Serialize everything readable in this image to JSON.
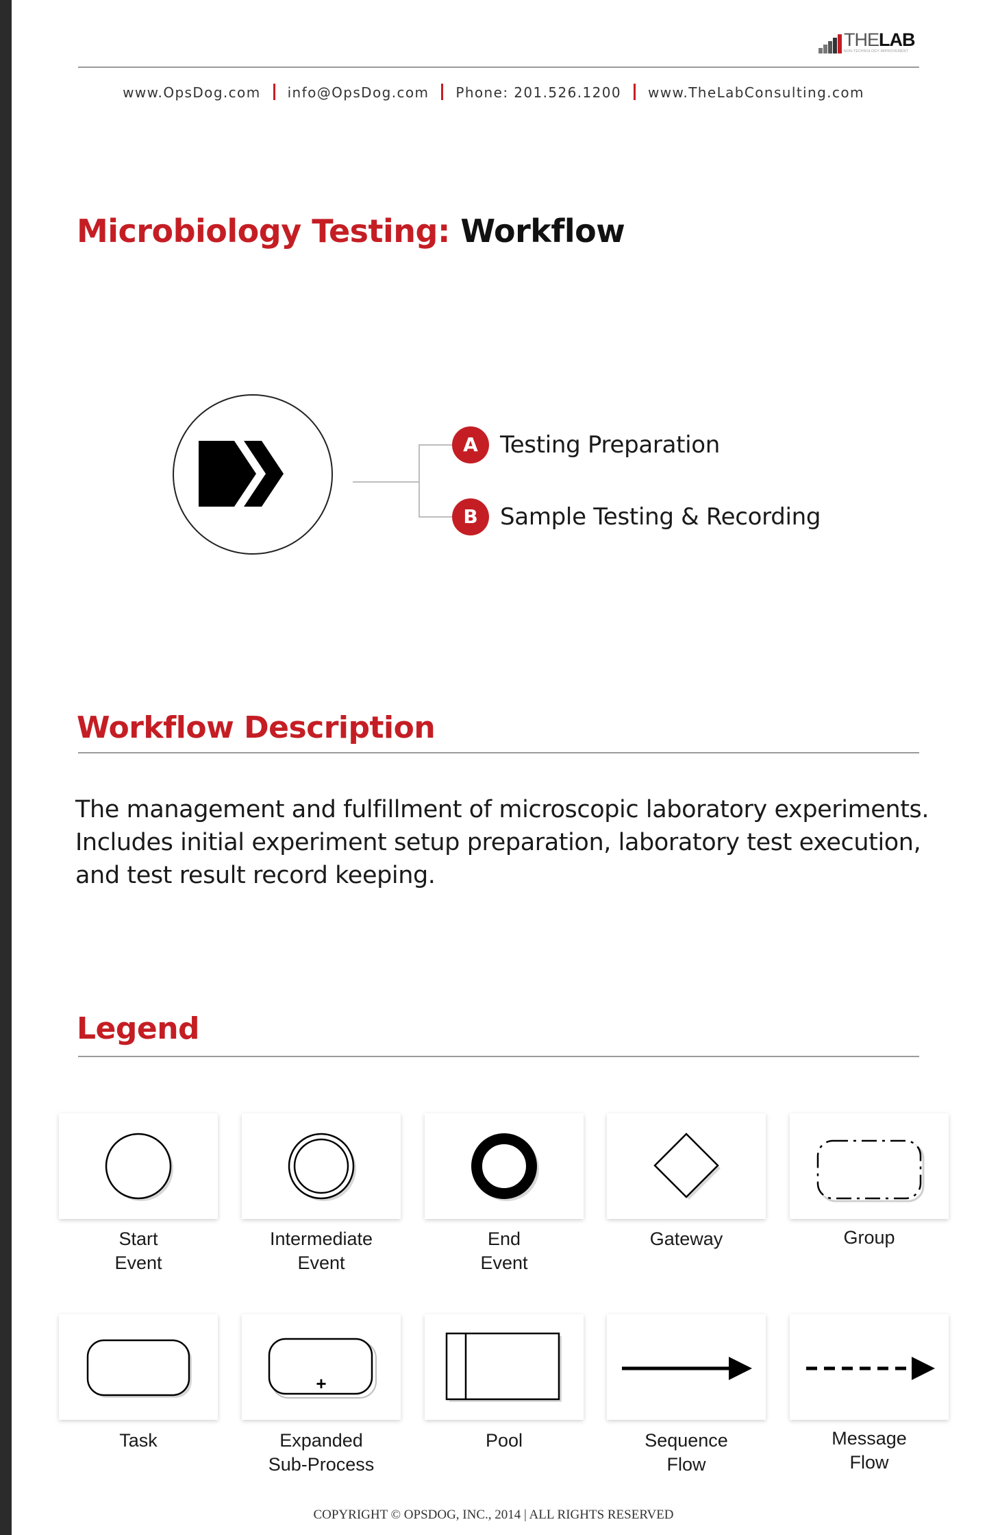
{
  "header": {
    "logo": {
      "the": "THE",
      "lab": "LAB",
      "tagline": "NON-TECHNOLOGY IMPROVEMENT"
    },
    "contact": {
      "website": "www.OpsDog.com",
      "email": "info@OpsDog.com",
      "phone": "Phone: 201.526.1200",
      "website2": "www.TheLabConsulting.com"
    }
  },
  "title": {
    "category": "Microbiology Testing:",
    "type": "Workflow"
  },
  "workflow": {
    "icon": "chevron-forward-icon",
    "steps": [
      {
        "badge": "A",
        "label": "Testing Preparation"
      },
      {
        "badge": "B",
        "label": "Sample Testing & Recording"
      }
    ]
  },
  "description": {
    "heading": "Workflow Description",
    "lines": [
      "The management and fulfillment of microscopic laboratory experiments.",
      "Includes initial experiment setup preparation, laboratory test execution,",
      "and test result record keeping."
    ]
  },
  "legend": {
    "heading": "Legend",
    "items": [
      {
        "icon": "start-event-icon",
        "line1": "Start",
        "line2": "Event"
      },
      {
        "icon": "intermediate-event-icon",
        "line1": "Intermediate",
        "line2": "Event"
      },
      {
        "icon": "end-event-icon",
        "line1": "End",
        "line2": "Event"
      },
      {
        "icon": "gateway-icon",
        "line1": "Gateway",
        "line2": ""
      },
      {
        "icon": "group-icon",
        "line1": "Group",
        "line2": ""
      },
      {
        "icon": "task-icon",
        "line1": "Task",
        "line2": ""
      },
      {
        "icon": "expanded-subprocess-icon",
        "line1": "Expanded",
        "line2": "Sub-Process"
      },
      {
        "icon": "pool-icon",
        "line1": "Pool",
        "line2": ""
      },
      {
        "icon": "sequence-flow-icon",
        "line1": "Sequence",
        "line2": "Flow"
      },
      {
        "icon": "message-flow-icon",
        "line1": "Message",
        "line2": "Flow"
      }
    ]
  },
  "footer": {
    "copyright": "COPYRIGHT © OPSDOG, INC., 2014 | ALL RIGHTS RESERVED"
  },
  "colors": {
    "accent": "#c41e24",
    "text": "#1a1a1a",
    "rule": "#9a9a9a"
  }
}
